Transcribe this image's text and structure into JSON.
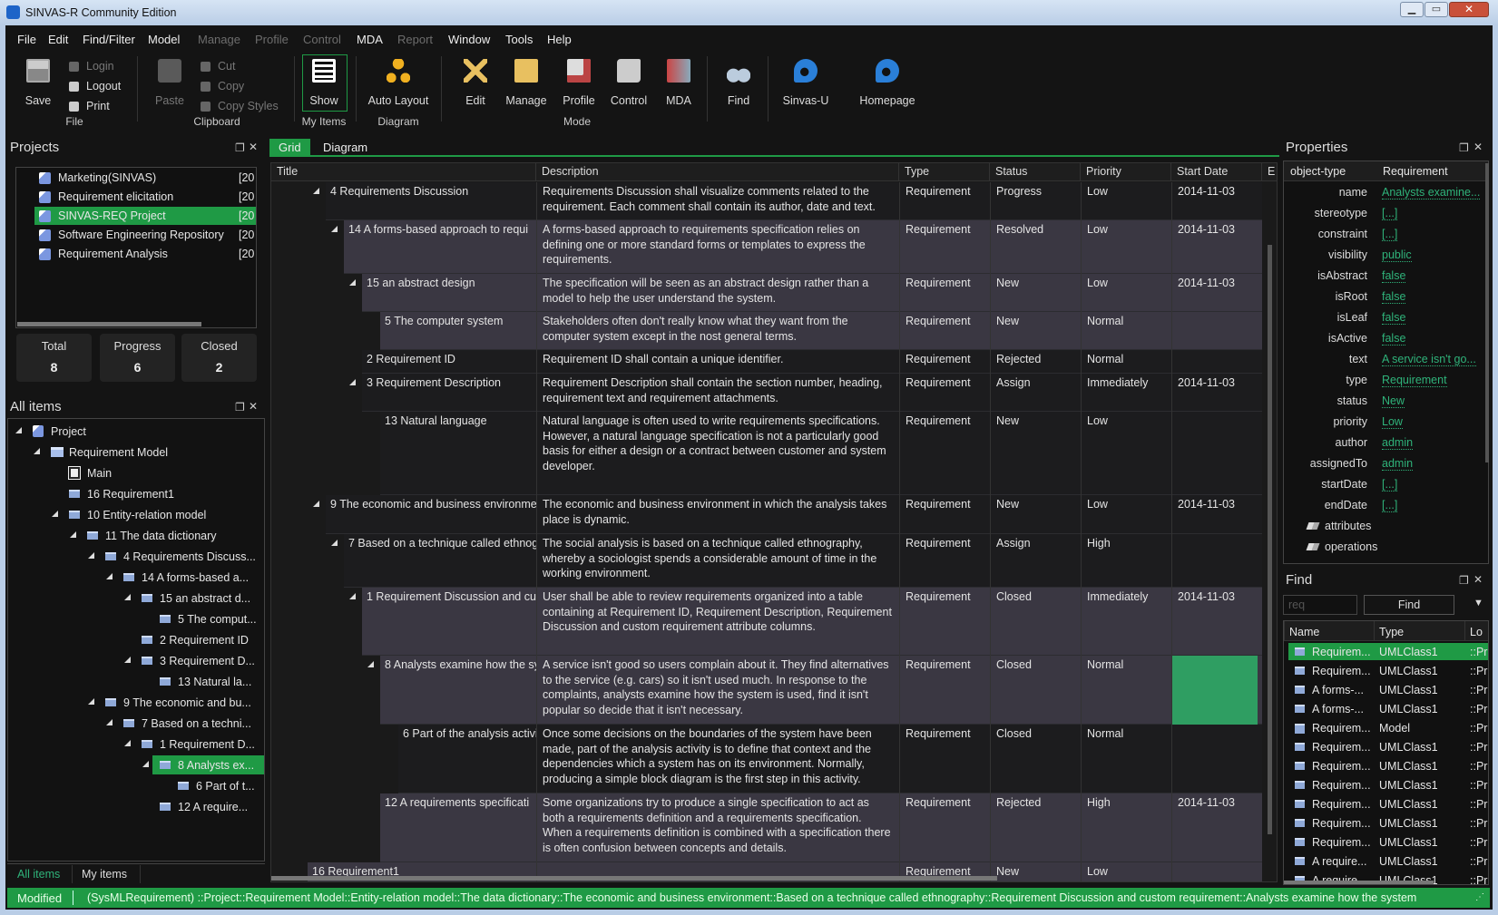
{
  "window": {
    "title": "SINVAS-R Community Edition"
  },
  "menu": [
    {
      "label": "File",
      "enabled": true
    },
    {
      "label": "Edit",
      "enabled": true
    },
    {
      "label": "Find/Filter",
      "enabled": true
    },
    {
      "label": "Model",
      "enabled": true
    },
    {
      "label": "Manage",
      "enabled": false
    },
    {
      "label": "Profile",
      "enabled": false
    },
    {
      "label": "Control",
      "enabled": false
    },
    {
      "label": "MDA",
      "enabled": true
    },
    {
      "label": "Report",
      "enabled": false
    },
    {
      "label": "Window",
      "enabled": true
    },
    {
      "label": "Tools",
      "enabled": true
    },
    {
      "label": "Help",
      "enabled": true
    }
  ],
  "toolbar": {
    "save": "Save",
    "login": "Login",
    "logout": "Logout",
    "print": "Print",
    "group_file": "File",
    "paste": "Paste",
    "cut": "Cut",
    "copy": "Copy",
    "copy_styles": "Copy Styles",
    "group_clipboard": "Clipboard",
    "show": "Show",
    "group_myitems": "My Items",
    "auto_layout": "Auto Layout",
    "group_diagram": "Diagram",
    "edit": "Edit",
    "manage": "Manage",
    "profile": "Profile",
    "control": "Control",
    "mda": "MDA",
    "group_mode": "Mode",
    "find": "Find",
    "sinvas_u": "Sinvas-U",
    "homepage": "Homepage"
  },
  "projects": {
    "title": "Projects",
    "items": [
      {
        "name": "Marketing(SINVAS)",
        "date": "[20"
      },
      {
        "name": "Requirement elicitation",
        "date": "[20"
      },
      {
        "name": "SINVAS-REQ Project",
        "date": "[20",
        "selected": true
      },
      {
        "name": "Software Engineering Repository",
        "date": "[20"
      },
      {
        "name": "Requirement Analysis",
        "date": "[20"
      }
    ],
    "stats": [
      {
        "label": "Total",
        "value": "8"
      },
      {
        "label": "Progress",
        "value": "6"
      },
      {
        "label": "Closed",
        "value": "2"
      }
    ]
  },
  "all_items": {
    "title": "All items",
    "tree": [
      {
        "label": "Project",
        "level": 0,
        "toggle": true,
        "icon": "project-icon"
      },
      {
        "label": "Requirement Model",
        "level": 1,
        "toggle": true,
        "icon": "model-icon"
      },
      {
        "label": "Main",
        "level": 2,
        "toggle": false,
        "icon": "diagram-icon"
      },
      {
        "label": "16 Requirement1",
        "level": 2,
        "toggle": false,
        "icon": "requirement-icon"
      },
      {
        "label": "10 Entity-relation model",
        "level": 2,
        "toggle": true,
        "icon": "requirement-icon"
      },
      {
        "label": "11 The data dictionary",
        "level": 3,
        "toggle": true,
        "icon": "requirement-icon"
      },
      {
        "label": "4 Requirements Discuss...",
        "level": 4,
        "toggle": true,
        "icon": "requirement-icon"
      },
      {
        "label": "14 A forms-based a...",
        "level": 5,
        "toggle": true,
        "icon": "requirement-icon"
      },
      {
        "label": "15 an abstract d...",
        "level": 6,
        "toggle": true,
        "icon": "requirement-icon"
      },
      {
        "label": "5 The comput...",
        "level": 7,
        "toggle": false,
        "icon": "requirement-icon"
      },
      {
        "label": "2 Requirement ID",
        "level": 6,
        "toggle": false,
        "icon": "requirement-icon"
      },
      {
        "label": "3 Requirement D...",
        "level": 6,
        "toggle": true,
        "icon": "requirement-icon"
      },
      {
        "label": "13 Natural la...",
        "level": 7,
        "toggle": false,
        "icon": "requirement-icon"
      },
      {
        "label": "9 The economic and bu...",
        "level": 4,
        "toggle": true,
        "icon": "requirement-icon"
      },
      {
        "label": "7 Based on a techni...",
        "level": 5,
        "toggle": true,
        "icon": "requirement-icon"
      },
      {
        "label": "1 Requirement D...",
        "level": 6,
        "toggle": true,
        "icon": "requirement-icon"
      },
      {
        "label": "8 Analysts ex...",
        "level": 7,
        "toggle": true,
        "icon": "requirement-icon",
        "selected": true
      },
      {
        "label": "6 Part of t...",
        "level": 8,
        "toggle": false,
        "icon": "requirement-icon"
      },
      {
        "label": "12 A require...",
        "level": 7,
        "toggle": false,
        "icon": "requirement-icon"
      }
    ],
    "tabs": [
      {
        "label": "All items",
        "active": true
      },
      {
        "label": "My items",
        "active": false
      }
    ]
  },
  "editor": {
    "tabs": [
      {
        "label": "Grid",
        "active": true
      },
      {
        "label": "Diagram",
        "active": false
      }
    ],
    "columns": [
      "Title",
      "Description",
      "Type",
      "Status",
      "Priority",
      "Start Date",
      "E"
    ],
    "rows": [
      {
        "title": "4 Requirements Discussion",
        "level": 0,
        "toggle": true,
        "shade": "dark",
        "description": "Requirements Discussion shall visualize comments related to the requirement. Each comment shall contain its author, date and text.",
        "type": "Requirement",
        "status": "Progress",
        "priority": "Low",
        "start": "2014-11-03"
      },
      {
        "title": "14 A forms-based approach to requi",
        "level": 1,
        "toggle": true,
        "shade": "light",
        "description": "A forms-based approach to requirements specification relies on defining one or more standard forms or templates to express the requirements.",
        "type": "Requirement",
        "status": "Resolved",
        "priority": "Low",
        "start": "2014-11-03"
      },
      {
        "title": "15 an abstract design",
        "level": 2,
        "toggle": true,
        "shade": "light",
        "description": "The specification will be seen as an abstract design rather than a model to help the user understand the system.",
        "type": "Requirement",
        "status": "New",
        "priority": "Low",
        "start": "2014-11-03"
      },
      {
        "title": "5 The computer system",
        "level": 3,
        "toggle": false,
        "shade": "light",
        "description": "Stakeholders often don't really know what they want from the computer system except in the nost general terms.",
        "type": "Requirement",
        "status": "New",
        "priority": "Normal",
        "start": ""
      },
      {
        "title": "2 Requirement ID",
        "level": 2,
        "toggle": false,
        "shade": "dark",
        "description": "Requirement ID shall contain a unique identifier.",
        "type": "Requirement",
        "status": "Rejected",
        "priority": "Normal",
        "start": ""
      },
      {
        "title": "3 Requirement Description",
        "level": 2,
        "toggle": true,
        "shade": "dark",
        "description": "Requirement Description shall contain the section number, heading, requirement text and requirement attachments.",
        "type": "Requirement",
        "status": "Assign",
        "priority": "Immediately",
        "start": "2014-11-03"
      },
      {
        "title": "13 Natural language",
        "level": 3,
        "toggle": false,
        "shade": "dark",
        "description": "Natural language is often used to write requirements specifications. However, a natural language specification is not a particularly good basis for either a design or a contract between customer and system developer.",
        "type": "Requirement",
        "status": "New",
        "priority": "Low",
        "start": ""
      },
      {
        "title": "9 The economic and business environme",
        "level": 0,
        "toggle": true,
        "shade": "dark",
        "description": "The economic and business environment in which the analysis takes place is dynamic.",
        "type": "Requirement",
        "status": "New",
        "priority": "Low",
        "start": "2014-11-03"
      },
      {
        "title": "7 Based on a technique called ethnog",
        "level": 1,
        "toggle": true,
        "shade": "dark",
        "description": "The social analysis is based on a technique called ethnography, whereby a sociologist spends a considerable amount of time in the working environment.",
        "type": "Requirement",
        "status": "Assign",
        "priority": "High",
        "start": ""
      },
      {
        "title": "1 Requirement Discussion and cu",
        "level": 2,
        "toggle": true,
        "shade": "light",
        "description": "User shall be able to review requirements organized into a table containing at Requirement ID, Requirement Description, Requirement Discussion and custom requirement attribute columns.",
        "type": "Requirement",
        "status": "Closed",
        "priority": "Immediately",
        "start": "2014-11-03"
      },
      {
        "title": "8 Analysts examine how the sy",
        "level": 3,
        "toggle": true,
        "shade": "light",
        "selected_cell": true,
        "description": "A service isn't good so users complain about it. They find alternatives to the service (e.g. cars) so it isn't used much. In response to the complaints, analysts examine how the system is used, find it isn't popular so decide that it isn't necessary.",
        "type": "Requirement",
        "status": "Closed",
        "priority": "Normal",
        "start": ""
      },
      {
        "title": "6 Part of the analysis activi",
        "level": 4,
        "toggle": false,
        "shade": "dark",
        "description": "Once some decisions on the boundaries of the system have been made, part of the analysis activity is to define that context and the dependencies which a system has on its environment. Normally, producing a simple block diagram is the first step in this activity.",
        "type": "Requirement",
        "status": "Closed",
        "priority": "Normal",
        "start": ""
      },
      {
        "title": "12 A requirements specificati",
        "level": 3,
        "toggle": false,
        "shade": "light",
        "description": "Some organizations try to produce a single specification to act as both a requirements definition and a requirements specification. When a requirements definition is combined with a specification there is often confusion between concepts and details.",
        "type": "Requirement",
        "status": "Rejected",
        "priority": "High",
        "start": "2014-11-03"
      },
      {
        "title": "16 Requirement1",
        "level": -1,
        "toggle": false,
        "shade": "light",
        "description": "",
        "type": "Requirement",
        "status": "New",
        "priority": "Low",
        "start": ""
      }
    ]
  },
  "properties": {
    "title": "Properties",
    "header_key": "object-type",
    "header_value": "Requirement",
    "rows": [
      {
        "k": "name",
        "v": "Analysts examine..."
      },
      {
        "k": "stereotype",
        "v": "[...]"
      },
      {
        "k": "constraint",
        "v": "[...]"
      },
      {
        "k": "visibility",
        "v": "public"
      },
      {
        "k": "isAbstract",
        "v": "false"
      },
      {
        "k": "isRoot",
        "v": "false"
      },
      {
        "k": "isLeaf",
        "v": "false"
      },
      {
        "k": "isActive",
        "v": "false"
      },
      {
        "k": "text",
        "v": "A service isn't go..."
      },
      {
        "k": "type",
        "v": "Requirement"
      },
      {
        "k": "status",
        "v": "New"
      },
      {
        "k": "priority",
        "v": "Low"
      },
      {
        "k": "author",
        "v": "admin"
      },
      {
        "k": "assignedTo",
        "v": "admin"
      },
      {
        "k": "startDate",
        "v": "[...]"
      },
      {
        "k": "endDate",
        "v": "[...]"
      }
    ],
    "groups": [
      "attributes",
      "operations"
    ]
  },
  "find": {
    "title": "Find",
    "input_value": "req",
    "button": "Find",
    "columns": [
      "Name",
      "Type",
      "Lo"
    ],
    "results": [
      {
        "name": "Requirem...",
        "type": "UMLClass1",
        "loc": "::Pr",
        "selected": true
      },
      {
        "name": "Requirem...",
        "type": "UMLClass1",
        "loc": "::Pr"
      },
      {
        "name": "A forms-...",
        "type": "UMLClass1",
        "loc": "::Pr"
      },
      {
        "name": "A forms-...",
        "type": "UMLClass1",
        "loc": "::Pr"
      },
      {
        "name": "Requirem...",
        "type": "Model",
        "loc": "::Pr",
        "model": true
      },
      {
        "name": "Requirem...",
        "type": "UMLClass1",
        "loc": "::Pr"
      },
      {
        "name": "Requirem...",
        "type": "UMLClass1",
        "loc": "::Pr"
      },
      {
        "name": "Requirem...",
        "type": "UMLClass1",
        "loc": "::Pr"
      },
      {
        "name": "Requirem...",
        "type": "UMLClass1",
        "loc": "::Pr"
      },
      {
        "name": "Requirem...",
        "type": "UMLClass1",
        "loc": "::Pr"
      },
      {
        "name": "Requirem...",
        "type": "UMLClass1",
        "loc": "::Pr"
      },
      {
        "name": "A require...",
        "type": "UMLClass1",
        "loc": "::Pr"
      },
      {
        "name": "A require...",
        "type": "UMLClass1",
        "loc": "::Pr"
      }
    ]
  },
  "status": {
    "state": "Modified",
    "path": "(SysMLRequirement) ::Project::Requirement Model::Entity-relation model::The data dictionary::The economic and business environment::Based on a technique called ethnography::Requirement Discussion and custom requirement::Analysts examine how the system"
  },
  "colors": {
    "accent": "#1f9a45",
    "link": "#2fb37a",
    "row_light": "#3a3742",
    "row_dark": "#1c1c1e"
  }
}
